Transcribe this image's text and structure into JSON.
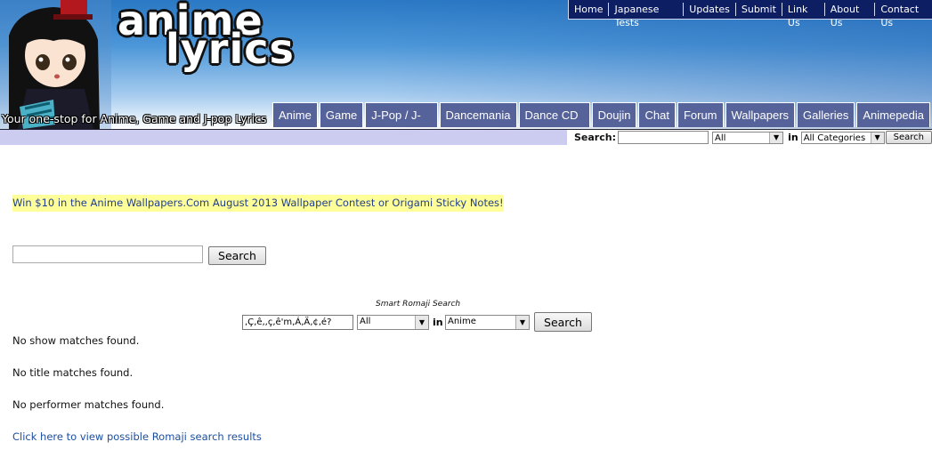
{
  "header": {
    "logo_line1": "anime",
    "logo_line2": "lyrics",
    "tagline": "Your one-stop for Anime, Game and J-pop Lyrics"
  },
  "top_links": [
    "Home",
    "Japanese Tests",
    "Updates",
    "Submit",
    "Link Us",
    "About Us",
    "Contact Us"
  ],
  "tabs": [
    "Anime",
    "Game",
    "J-Pop / J-Rock",
    "Dancemania",
    "Dance CD List",
    "Doujin",
    "Chat",
    "Forum",
    "Wallpapers",
    "Galleries",
    "Animepedia"
  ],
  "search_bar": {
    "label": "Search:",
    "input_value": "",
    "type_select": "All",
    "in_label": "in",
    "category_select": "All Categories",
    "button": "Search"
  },
  "promo": "Win $10 in the Anime Wallpapers.Com August 2013 Wallpaper Contest or Origami Sticky Notes!",
  "main_search": {
    "input_value": "",
    "button": "Search"
  },
  "smart_search": {
    "label": "Smart Romaji Search",
    "input_value": ",Ç‚ê‚,ç,ê'm‚Á‚Ä‚¢‚é?",
    "select1": "All",
    "in_label": "in",
    "select2": "Anime",
    "button": "Search"
  },
  "results": {
    "show": "No show matches found.",
    "title": "No title matches found.",
    "performer": "No performer matches found.",
    "romaji_link": "Click here to view possible Romaji search results"
  }
}
